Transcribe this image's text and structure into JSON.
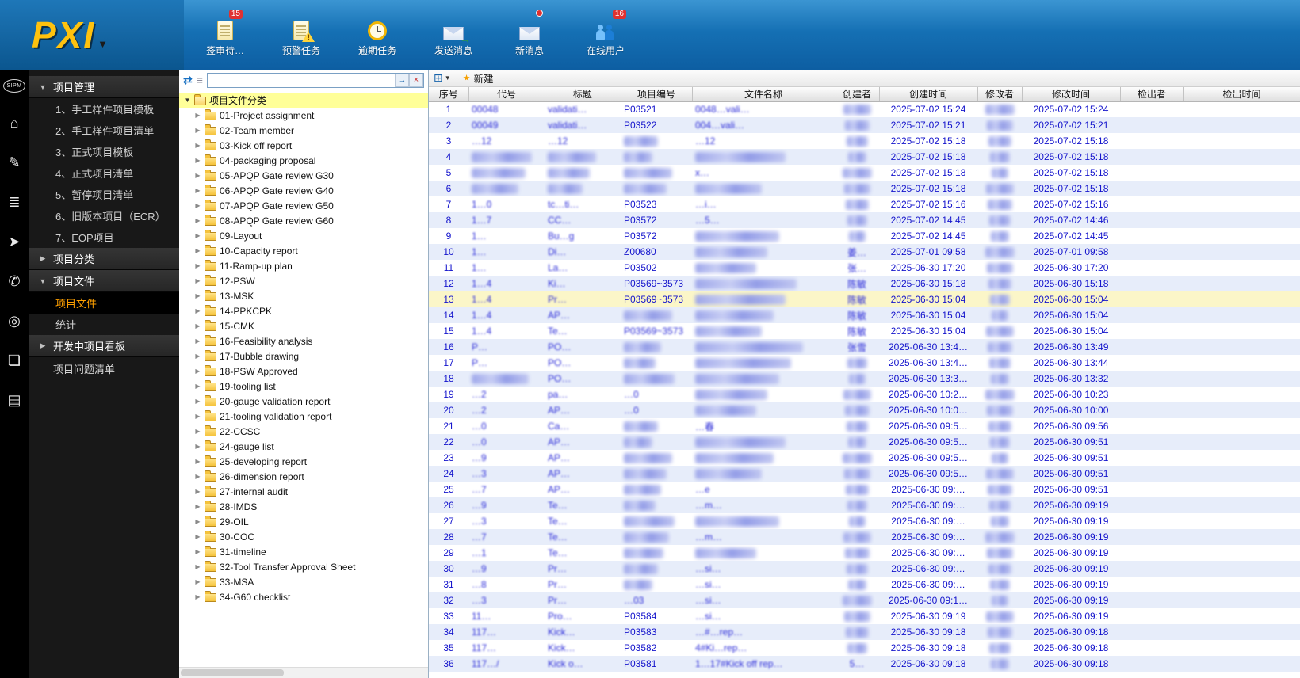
{
  "topbar": {
    "logo": "PXI",
    "items": [
      {
        "label": "签审待…",
        "icon": "pending-approval-icon",
        "badge": "15"
      },
      {
        "label": "预警任务",
        "icon": "warning-task-icon",
        "badge": ""
      },
      {
        "label": "逾期任务",
        "icon": "overdue-task-icon",
        "badge": ""
      },
      {
        "label": "发送消息",
        "icon": "send-message-icon",
        "badge": ""
      },
      {
        "label": "新消息",
        "icon": "new-message-icon",
        "badge": ""
      },
      {
        "label": "在线用户",
        "icon": "online-users-icon",
        "badge": "16"
      }
    ]
  },
  "rail": {
    "icons": [
      {
        "name": "sipm-logo",
        "glyph": "SIPM"
      },
      {
        "name": "home-icon",
        "glyph": "⌂"
      },
      {
        "name": "edit-icon",
        "glyph": "✎"
      },
      {
        "name": "database-icon",
        "glyph": "≣"
      },
      {
        "name": "send-icon",
        "glyph": "➤"
      },
      {
        "name": "chat-icon",
        "glyph": "✆"
      },
      {
        "name": "user-circle-icon",
        "glyph": "◎"
      },
      {
        "name": "book-icon",
        "glyph": "❏"
      },
      {
        "name": "id-card-icon",
        "glyph": "▤"
      }
    ]
  },
  "nav": {
    "sections": [
      {
        "label": "项目管理",
        "state": "expanded",
        "selected": "",
        "items": [
          "1、手工样件项目模板",
          "2、手工样件项目清单",
          "3、正式项目模板",
          "4、正式项目清单",
          "5、暂停项目清单",
          "6、旧版本项目（ECR）",
          "7、EOP项目"
        ]
      },
      {
        "label": "项目分类",
        "state": "collapsed",
        "selected": "",
        "items": []
      },
      {
        "label": "项目文件",
        "state": "expanded",
        "selected": "项目文件",
        "items": [
          "项目文件",
          "统计"
        ]
      },
      {
        "label": "开发中项目看板",
        "state": "collapsed",
        "selected": "",
        "items": []
      },
      {
        "label": "项目问题清单",
        "state": "leaf",
        "selected": "",
        "items": []
      }
    ]
  },
  "tree": {
    "root": "项目文件分类",
    "search_value": "",
    "folders": [
      "01-Project assignment",
      "02-Team member",
      "03-Kick off report",
      "04-packaging proposal",
      "05-APQP Gate review G30",
      "06-APQP Gate review G40",
      "07-APQP Gate review G50",
      "08-APQP Gate review G60",
      "09-Layout",
      "10-Capacity report",
      "11-Ramp-up plan",
      "12-PSW",
      "13-MSK",
      "14-PPKCPK",
      "15-CMK",
      "16-Feasibility analysis",
      "17-Bubble drawing",
      "18-PSW Approved",
      "19-tooling list",
      "20-gauge validation report",
      "21-tooling validation report",
      "22-CCSC",
      "24-gauge list",
      "25-developing report",
      "26-dimension report",
      "27-internal audit",
      "28-IMDS",
      "29-OIL",
      "30-COC",
      "31-timeline",
      "32-Tool Transfer Approval Sheet",
      "33-MSA",
      "34-G60 checklist"
    ]
  },
  "table": {
    "new_button": "新建",
    "columns": [
      "序号",
      "代号",
      "标题",
      "项目编号",
      "文件名称",
      "创建者",
      "创建时间",
      "修改者",
      "修改时间",
      "检出者",
      "检出时间"
    ],
    "highlight_row": 13,
    "rows": [
      [
        "1",
        {
          "t": "00048",
          "b": "soft"
        },
        {
          "t": "validati…",
          "b": "soft"
        },
        "P03521",
        {
          "t": "0048…vali…",
          "b": "soft"
        },
        {
          "b": "smudge"
        },
        "2025-07-02 15:24",
        {
          "b": "smudge"
        },
        "2025-07-02 15:24",
        "",
        ""
      ],
      [
        "2",
        {
          "t": "00049",
          "b": "soft"
        },
        {
          "t": "validati…",
          "b": "soft"
        },
        "P03522",
        {
          "t": "004…vali…",
          "b": "soft"
        },
        {
          "b": "smudge"
        },
        "2025-07-02 15:21",
        {
          "b": "smudge"
        },
        "2025-07-02 15:21",
        "",
        ""
      ],
      [
        "3",
        {
          "t": "…12",
          "b": "soft"
        },
        {
          "t": "…12",
          "b": "soft"
        },
        {
          "b": "smudge"
        },
        {
          "t": "…12",
          "b": "soft"
        },
        {
          "b": "smudge"
        },
        "2025-07-02 15:18",
        {
          "b": "smudge"
        },
        "2025-07-02 15:18",
        "",
        ""
      ],
      [
        "4",
        {
          "b": "smudge"
        },
        {
          "b": "smudge"
        },
        {
          "b": "smudge"
        },
        {
          "b": "smudge"
        },
        {
          "b": "smudge"
        },
        "2025-07-02 15:18",
        {
          "b": "smudge"
        },
        "2025-07-02 15:18",
        "",
        ""
      ],
      [
        "5",
        {
          "b": "smudge"
        },
        {
          "b": "smudge"
        },
        {
          "b": "smudge"
        },
        {
          "t": "x…",
          "b": "soft"
        },
        {
          "b": "smudge"
        },
        "2025-07-02 15:18",
        {
          "b": "smudge"
        },
        "2025-07-02 15:18",
        "",
        ""
      ],
      [
        "6",
        {
          "b": "smudge"
        },
        {
          "b": "smudge"
        },
        {
          "b": "smudge"
        },
        {
          "b": "smudge"
        },
        {
          "b": "smudge"
        },
        "2025-07-02 15:18",
        {
          "b": "smudge"
        },
        "2025-07-02 15:18",
        "",
        ""
      ],
      [
        "7",
        {
          "t": "1…0",
          "b": "soft"
        },
        {
          "t": "tc…ti…",
          "b": "soft"
        },
        "P03523",
        {
          "t": "…i…",
          "b": "soft"
        },
        {
          "b": "smudge"
        },
        "2025-07-02 15:16",
        {
          "b": "smudge"
        },
        "2025-07-02 15:16",
        "",
        ""
      ],
      [
        "8",
        {
          "t": "1…7",
          "b": "soft"
        },
        {
          "t": "CC…",
          "b": "soft"
        },
        "P03572",
        {
          "t": "…5…",
          "b": "soft"
        },
        {
          "b": "smudge"
        },
        "2025-07-02 14:45",
        {
          "b": "smudge"
        },
        "2025-07-02 14:46",
        "",
        ""
      ],
      [
        "9",
        {
          "t": "1…",
          "b": "soft"
        },
        {
          "t": "Bu…g",
          "b": "soft"
        },
        "P03572",
        {
          "b": "smudge"
        },
        {
          "b": "smudge"
        },
        "2025-07-02 14:45",
        {
          "b": "smudge"
        },
        "2025-07-02 14:45",
        "",
        ""
      ],
      [
        "10",
        {
          "t": "1…",
          "b": "soft"
        },
        {
          "t": "Di…",
          "b": "soft"
        },
        "Z00680",
        {
          "b": "smudge"
        },
        {
          "t": "姜…",
          "b": "soft"
        },
        "2025-07-01 09:58",
        {
          "b": "smudge"
        },
        "2025-07-01 09:58",
        "",
        ""
      ],
      [
        "11",
        {
          "t": "1…",
          "b": "soft"
        },
        {
          "t": "La…",
          "b": "soft"
        },
        "P03502",
        {
          "b": "smudge"
        },
        {
          "t": "张…",
          "b": "soft"
        },
        "2025-06-30 17:20",
        {
          "b": "smudge"
        },
        "2025-06-30 17:20",
        "",
        ""
      ],
      [
        "12",
        {
          "t": "1…4",
          "b": "soft"
        },
        {
          "t": "Ki…",
          "b": "soft"
        },
        "P03569~3573",
        {
          "b": "smudge"
        },
        {
          "t": "陈敏",
          "b": "soft"
        },
        "2025-06-30 15:18",
        {
          "b": "smudge"
        },
        "2025-06-30 15:18",
        "",
        ""
      ],
      [
        "13",
        {
          "t": "1…4",
          "b": "soft"
        },
        {
          "t": "Pr…",
          "b": "soft"
        },
        "P03569~3573",
        {
          "b": "smudge"
        },
        {
          "t": "陈敏",
          "b": "soft"
        },
        "2025-06-30 15:04",
        {
          "b": "smudge"
        },
        "2025-06-30 15:04",
        "",
        ""
      ],
      [
        "14",
        {
          "t": "1…4",
          "b": "soft"
        },
        {
          "t": "AP…",
          "b": "soft"
        },
        {
          "b": "smudge"
        },
        {
          "b": "smudge"
        },
        {
          "t": "陈敏",
          "b": "soft"
        },
        "2025-06-30 15:04",
        {
          "b": "smudge"
        },
        "2025-06-30 15:04",
        "",
        ""
      ],
      [
        "15",
        {
          "t": "1…4",
          "b": "soft"
        },
        {
          "t": "Te…",
          "b": "soft"
        },
        {
          "t": "P03569~3573",
          "b": "soft"
        },
        {
          "b": "smudge"
        },
        {
          "t": "陈敏",
          "b": "soft"
        },
        "2025-06-30 15:04",
        {
          "b": "smudge"
        },
        "2025-06-30 15:04",
        "",
        ""
      ],
      [
        "16",
        {
          "t": "P…",
          "b": "soft"
        },
        {
          "t": "PO…",
          "b": "soft"
        },
        {
          "b": "smudge"
        },
        {
          "b": "smudge"
        },
        {
          "t": "张雪",
          "b": "soft"
        },
        "2025-06-30 13:4…",
        {
          "b": "smudge"
        },
        "2025-06-30 13:49",
        "",
        ""
      ],
      [
        "17",
        {
          "t": "P…",
          "b": "soft"
        },
        {
          "t": "PO…",
          "b": "soft"
        },
        {
          "b": "smudge"
        },
        {
          "b": "smudge"
        },
        {
          "b": "smudge"
        },
        "2025-06-30 13:4…",
        {
          "b": "smudge"
        },
        "2025-06-30 13:44",
        "",
        ""
      ],
      [
        "18",
        {
          "b": "smudge"
        },
        {
          "t": "PO…",
          "b": "soft"
        },
        {
          "b": "smudge"
        },
        {
          "b": "smudge"
        },
        {
          "b": "smudge"
        },
        "2025-06-30 13:3…",
        {
          "b": "smudge"
        },
        "2025-06-30 13:32",
        "",
        ""
      ],
      [
        "19",
        {
          "t": "…2",
          "b": "soft"
        },
        {
          "t": "pa…",
          "b": "soft"
        },
        {
          "t": "…0",
          "b": "soft"
        },
        {
          "b": "smudge"
        },
        {
          "b": "smudge"
        },
        "2025-06-30 10:2…",
        {
          "b": "smudge"
        },
        "2025-06-30 10:23",
        "",
        ""
      ],
      [
        "20",
        {
          "t": "…2",
          "b": "soft"
        },
        {
          "t": "AP…",
          "b": "soft"
        },
        {
          "t": "…0",
          "b": "soft"
        },
        {
          "b": "smudge"
        },
        {
          "b": "smudge"
        },
        "2025-06-30 10:0…",
        {
          "b": "smudge"
        },
        "2025-06-30 10:00",
        "",
        ""
      ],
      [
        "21",
        {
          "t": "…0",
          "b": "soft"
        },
        {
          "t": "Ca…",
          "b": "soft"
        },
        {
          "b": "smudge"
        },
        {
          "t": "…春",
          "b": "soft"
        },
        {
          "b": "smudge"
        },
        "2025-06-30 09:5…",
        {
          "b": "smudge"
        },
        "2025-06-30 09:56",
        "",
        ""
      ],
      [
        "22",
        {
          "t": "…0",
          "b": "soft"
        },
        {
          "t": "AP…",
          "b": "soft"
        },
        {
          "b": "smudge"
        },
        {
          "b": "smudge"
        },
        {
          "b": "smudge"
        },
        "2025-06-30 09:5…",
        {
          "b": "smudge"
        },
        "2025-06-30 09:51",
        "",
        ""
      ],
      [
        "23",
        {
          "t": "…9",
          "b": "soft"
        },
        {
          "t": "AP…",
          "b": "soft"
        },
        {
          "b": "smudge"
        },
        {
          "b": "smudge"
        },
        {
          "b": "smudge"
        },
        "2025-06-30 09:5…",
        {
          "b": "smudge"
        },
        "2025-06-30 09:51",
        "",
        ""
      ],
      [
        "24",
        {
          "t": "…3",
          "b": "soft"
        },
        {
          "t": "AP…",
          "b": "soft"
        },
        {
          "b": "smudge"
        },
        {
          "b": "smudge"
        },
        {
          "b": "smudge"
        },
        "2025-06-30 09:5…",
        {
          "b": "smudge"
        },
        "2025-06-30 09:51",
        "",
        ""
      ],
      [
        "25",
        {
          "t": "…7",
          "b": "soft"
        },
        {
          "t": "AP…",
          "b": "soft"
        },
        {
          "b": "smudge"
        },
        {
          "t": "…e",
          "b": "soft"
        },
        {
          "b": "smudge"
        },
        "2025-06-30 09:…",
        {
          "b": "smudge"
        },
        "2025-06-30 09:51",
        "",
        ""
      ],
      [
        "26",
        {
          "t": "…9",
          "b": "soft"
        },
        {
          "t": "Te…",
          "b": "soft"
        },
        {
          "b": "smudge"
        },
        {
          "t": "…m…",
          "b": "soft"
        },
        {
          "b": "smudge"
        },
        "2025-06-30 09:…",
        {
          "b": "smudge"
        },
        "2025-06-30 09:19",
        "",
        ""
      ],
      [
        "27",
        {
          "t": "…3",
          "b": "soft"
        },
        {
          "t": "Te…",
          "b": "soft"
        },
        {
          "b": "smudge"
        },
        {
          "b": "smudge"
        },
        {
          "b": "smudge"
        },
        "2025-06-30 09:…",
        {
          "b": "smudge"
        },
        "2025-06-30 09:19",
        "",
        ""
      ],
      [
        "28",
        {
          "t": "…7",
          "b": "soft"
        },
        {
          "t": "Te…",
          "b": "soft"
        },
        {
          "b": "smudge"
        },
        {
          "t": "…m…",
          "b": "soft"
        },
        {
          "b": "smudge"
        },
        "2025-06-30 09:…",
        {
          "b": "smudge"
        },
        "2025-06-30 09:19",
        "",
        ""
      ],
      [
        "29",
        {
          "t": "…1",
          "b": "soft"
        },
        {
          "t": "Te…",
          "b": "soft"
        },
        {
          "b": "smudge"
        },
        {
          "b": "smudge"
        },
        {
          "b": "smudge"
        },
        "2025-06-30 09:…",
        {
          "b": "smudge"
        },
        "2025-06-30 09:19",
        "",
        ""
      ],
      [
        "30",
        {
          "t": "…9",
          "b": "soft"
        },
        {
          "t": "Pr…",
          "b": "soft"
        },
        {
          "b": "smudge"
        },
        {
          "t": "…si…",
          "b": "soft"
        },
        {
          "b": "smudge"
        },
        "2025-06-30 09:…",
        {
          "b": "smudge"
        },
        "2025-06-30 09:19",
        "",
        ""
      ],
      [
        "31",
        {
          "t": "…8",
          "b": "soft"
        },
        {
          "t": "Pr…",
          "b": "soft"
        },
        {
          "b": "smudge"
        },
        {
          "t": "…si…",
          "b": "soft"
        },
        {
          "b": "smudge"
        },
        "2025-06-30 09:…",
        {
          "b": "smudge"
        },
        "2025-06-30 09:19",
        "",
        ""
      ],
      [
        "32",
        {
          "t": "…3",
          "b": "soft"
        },
        {
          "t": "Pr…",
          "b": "soft"
        },
        {
          "t": "…03",
          "b": "soft"
        },
        {
          "t": "…si…",
          "b": "soft"
        },
        {
          "b": "smudge"
        },
        "2025-06-30 09:1…",
        {
          "b": "smudge"
        },
        "2025-06-30 09:19",
        "",
        ""
      ],
      [
        "33",
        {
          "t": "11…",
          "b": "soft"
        },
        {
          "t": "Pro…",
          "b": "soft"
        },
        "P03584",
        {
          "t": "…si…",
          "b": "soft"
        },
        {
          "b": "smudge"
        },
        "2025-06-30 09:19",
        {
          "b": "smudge"
        },
        "2025-06-30 09:19",
        "",
        ""
      ],
      [
        "34",
        {
          "t": "117…",
          "b": "soft"
        },
        {
          "t": "Kick…",
          "b": "soft"
        },
        "P03583",
        {
          "t": "…#…rep…",
          "b": "soft"
        },
        {
          "b": "smudge"
        },
        "2025-06-30 09:18",
        {
          "b": "smudge"
        },
        "2025-06-30 09:18",
        "",
        ""
      ],
      [
        "35",
        {
          "t": "117…",
          "b": "soft"
        },
        {
          "t": "Kick…",
          "b": "soft"
        },
        "P03582",
        {
          "t": "4#Ki…rep…",
          "b": "soft"
        },
        {
          "b": "smudge"
        },
        "2025-06-30 09:18",
        {
          "b": "smudge"
        },
        "2025-06-30 09:18",
        "",
        ""
      ],
      [
        "36",
        {
          "t": "117…/",
          "b": "soft"
        },
        {
          "t": "Kick o…",
          "b": "soft"
        },
        "P03581",
        {
          "t": "1…17#Kick off rep…",
          "b": "soft"
        },
        {
          "t": "5…",
          "b": "soft"
        },
        "2025-06-30 09:18",
        {
          "b": "smudge"
        },
        "2025-06-30 09:18",
        "",
        ""
      ]
    ]
  },
  "colors": {
    "topbar_blue": "#1570b4",
    "logo_yellow": "#ffc20e",
    "badge_red": "#e03131",
    "nav_selected_orange": "#ffa000",
    "tree_highlight_yellow": "#ffff99",
    "row_alt_blue": "#e7edfa",
    "row_highlight_yellow": "#fbf6c8",
    "cell_text_blue": "#1414cc"
  }
}
